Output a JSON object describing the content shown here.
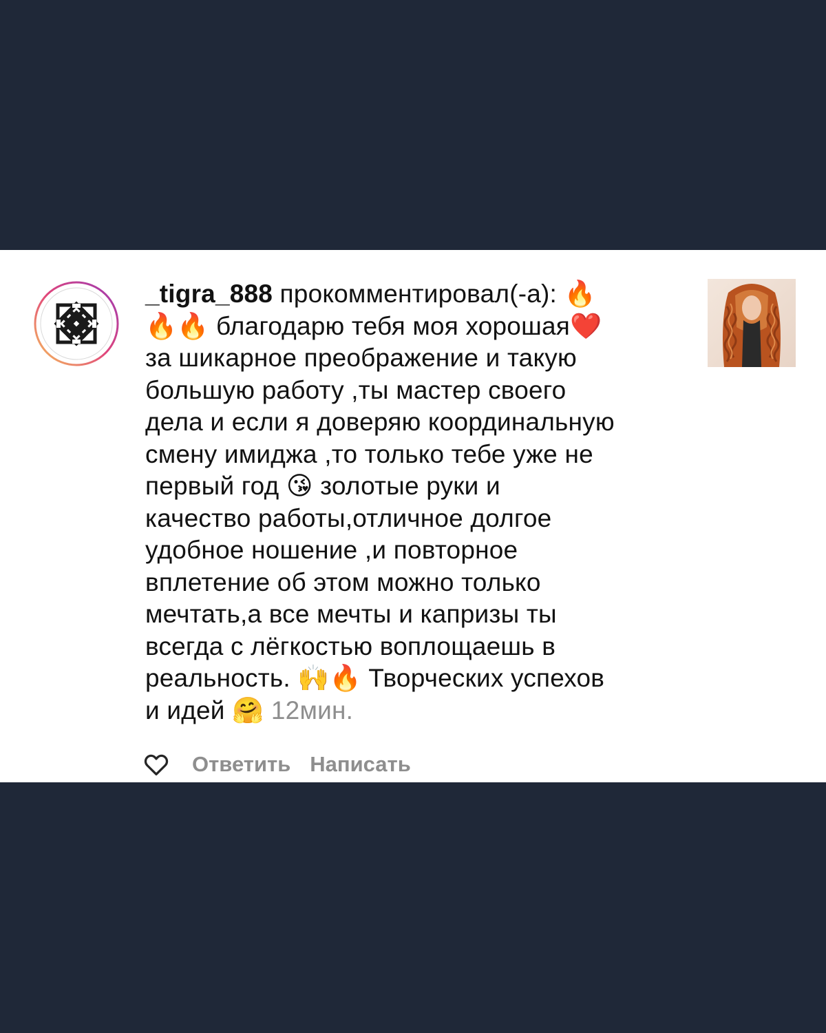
{
  "comment": {
    "username": "_tigra_888",
    "text": " прокомментировал(-а): 🔥\n🔥🔥 благодарю тебя моя хорошая❤️\nза шикарное преображение и такую\nбольшую работу ,ты мастер своего\nдела и если я доверяю координальную\nсмену имиджа ,то только тебе уже не\nпервый год 😘 золотые руки и\nкачество работы,отличное долгое\nудобное ношение ,и повторное\nвплетение об этом можно только\nмечтать,а все мечты и капризы ты\nвсегда с лёгкостью воплощаешь в\nреальность. 🙌🔥 Творческих успехов\nи идей 🤗 ",
    "time": "12мин."
  },
  "actions": {
    "reply_label": "Ответить",
    "message_label": "Написать"
  },
  "icons": {
    "like": "heart-outline-icon",
    "avatar": "knot-logo-avatar",
    "post": "post-thumbnail"
  },
  "colors": {
    "background": "#1f2838",
    "card": "#ffffff",
    "text": "#121212",
    "muted": "#8e8e8e"
  }
}
